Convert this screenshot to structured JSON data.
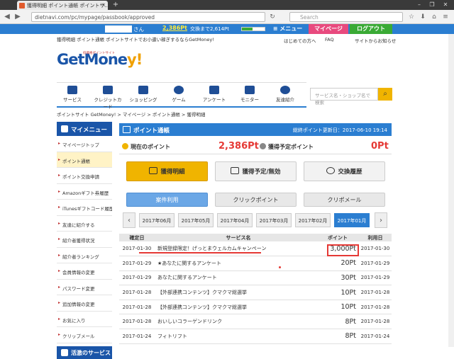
{
  "browser": {
    "tab_title": "獲得明細 ポイント通帳 ポイントサ...",
    "url": "dietnavi.com/pc/mypage/passbook/approved",
    "search_placeholder": "Search"
  },
  "userbar": {
    "name_suffix": "さん",
    "points": "2,386Pt",
    "next_label": "交換まで2,614Pt",
    "progress": 0.48,
    "menu_label": "≡ メニュー",
    "mypage_label": "マイページ",
    "logout_label": "ログアウト",
    "colors": {
      "bar": "#2b7ed1",
      "menu": "#2b7ed1",
      "mypage": "#e84a7e",
      "logout": "#3aaa35"
    }
  },
  "header": {
    "tagline": "獲得明細 ポイント通帳 ポイントサイトでお小遣い稼ぎするならGetMoney!",
    "links": [
      "はじめての方へ",
      "FAQ",
      "サイトからお知らせ"
    ],
    "logo_main": "GetMone",
    "logo_accent": "y!",
    "logo_sub": "低価格ポイントサイト"
  },
  "catnav": [
    {
      "label": "サービス",
      "icon": "service-icon"
    },
    {
      "label": "クレジットカード",
      "icon": "credit-card-icon"
    },
    {
      "label": "ショッピング",
      "icon": "cart-icon"
    },
    {
      "label": "ゲーム",
      "icon": "game-icon"
    },
    {
      "label": "アンケート",
      "icon": "survey-icon"
    },
    {
      "label": "モニター",
      "icon": "monitor-icon"
    },
    {
      "label": "友達紹介",
      "icon": "friend-icon"
    }
  ],
  "site_search": {
    "placeholder": "サービス名・ショップ名で検索"
  },
  "breadcrumb": "ポイントサイト GetMoney! > マイページ > ポイント通帳 > 獲得明細",
  "sidebar": {
    "title": "マイメニュー",
    "items": [
      "マイページトップ",
      "ポイント通帳",
      "ポイント交換申請",
      "Amazonギフト券履歴",
      "iTunesギフトコード履歴",
      "友達に紹介する",
      "紹介者獲得状況",
      "紹介者ランキング",
      "会員情報の変更",
      "パスワード変更",
      "追加情報の変更",
      "お気に入り",
      "クリップメール"
    ],
    "section2": "活激のサービス"
  },
  "main": {
    "title": "ポイント通帳",
    "updated": "総終ポイント更新日：2017-06-10 19:14",
    "current_label": "現在のポイント",
    "current_value": "2,386Pt",
    "planned_label": "獲得予定ポイント",
    "planned_value": "0Pt",
    "tabs": [
      "獲得明細",
      "獲得予定/無効",
      "交換履歴"
    ],
    "subtabs": [
      "案件利用",
      "クリックポイント",
      "クリポメール"
    ],
    "months": [
      "2017年06月",
      "2017年05月",
      "2017年04月",
      "2017年03月",
      "2017年02月",
      "2017年01月"
    ],
    "prev": "‹",
    "next": "›"
  },
  "table": {
    "headers": [
      "確定日",
      "サービス名",
      "ポイント",
      "利用日"
    ],
    "rows": [
      [
        "2017-01-30",
        "新規登録限定！げっとまウェルカムキャンペーン",
        "3,000Pt",
        "2017-01-30"
      ],
      [
        "2017-01-29",
        "★あなたに関するアンケート",
        "20Pt",
        "2017-01-29"
      ],
      [
        "2017-01-29",
        "あなたに関するアンケート",
        "30Pt",
        "2017-01-29"
      ],
      [
        "2017-01-28",
        "【外部連携コンテンツ】クマクマ総選挙",
        "10Pt",
        "2017-01-28"
      ],
      [
        "2017-01-28",
        "【外部連携コンテンツ】クマクマ総選挙",
        "10Pt",
        "2017-01-28"
      ],
      [
        "2017-01-28",
        "おいしいコラーゲンドリンク",
        "8Pt",
        "2017-01-28"
      ],
      [
        "2017-01-24",
        "フィトリフト",
        "8Pt",
        "2017-01-24"
      ]
    ]
  }
}
